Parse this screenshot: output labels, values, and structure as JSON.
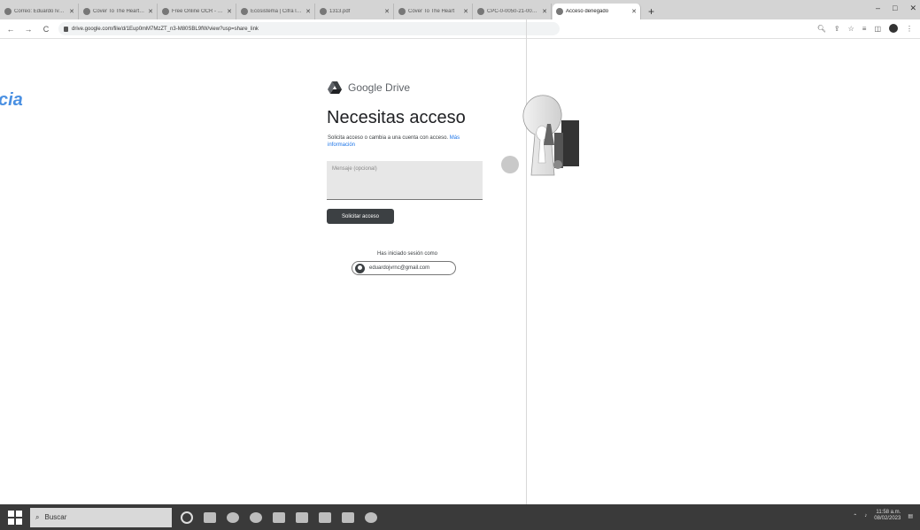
{
  "browser": {
    "tabs": [
      {
        "title": "Correo: Eduardo Ivonne",
        "icon": "outlook-icon"
      },
      {
        "title": "Cover To The Heart - Pooh",
        "icon": "youtube-icon"
      },
      {
        "title": "Free Online OCR - convert",
        "icon": "ocr-icon"
      },
      {
        "title": "Ecosistema | Cifra los ca",
        "icon": "site-icon"
      },
      {
        "title": "1313.pdf",
        "icon": "pdf-icon"
      },
      {
        "title": "Cover To The Heart",
        "icon": "youtube-icon"
      },
      {
        "title": "CPC-0-0050-21-004.pdf",
        "icon": "drive-icon"
      },
      {
        "title": "Acceso denegado",
        "icon": "drive-icon",
        "active": true
      }
    ],
    "new_tab": "+",
    "window_controls": {
      "minimize": "–",
      "maximize": "□",
      "close": "✕"
    },
    "nav": {
      "back": "←",
      "forward": "→",
      "reload": "C"
    },
    "url": "drive.google.com/file/d/1Eup0mM7MzZT_n3-M80SBL9fW/view?usp=share_link",
    "toolbar_icons": [
      "zoom-icon",
      "share-icon",
      "star-icon",
      "reading-list-icon",
      "sidebar-icon",
      "profile-icon",
      "menu-icon"
    ]
  },
  "page": {
    "partial_logo": "cia",
    "brand": "Google Drive",
    "heading": "Necesitas acceso",
    "subtext": "Solicita acceso o cambia a una cuenta con acceso.",
    "more_info": "Más información",
    "message_placeholder": "Mensaje (opcional)",
    "request_button": "Solicitar acceso",
    "signed_in_label": "Has iniciado sesión como",
    "account_email": "eduardojvrnc@gmail.com"
  },
  "taskbar": {
    "search_placeholder": "Buscar",
    "pinned": [
      "cortana-icon",
      "task-view-icon",
      "chrome-icon",
      "edge-icon",
      "explorer-icon",
      "store-icon",
      "word-icon",
      "excel-icon",
      "settings-icon"
    ],
    "clock_time": "11:58 a.m.",
    "clock_date": "08/02/2023"
  }
}
